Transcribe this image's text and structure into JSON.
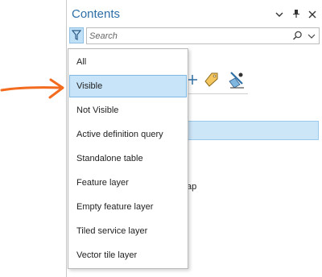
{
  "pane": {
    "title": "Contents",
    "controls": {
      "menu_icon": "chevron-down-icon",
      "pin_icon": "pin-icon",
      "close_icon": "close-icon"
    }
  },
  "search": {
    "placeholder": "Search",
    "search_icon": "magnifier-icon",
    "dropdown_icon": "chevron-down-icon"
  },
  "filter": {
    "icon": "filter-funnel-icon",
    "options": [
      "All",
      "Visible",
      "Not Visible",
      "Active definition query",
      "Standalone table",
      "Feature layer",
      "Empty feature layer",
      "Tiled service layer",
      "Vector tile layer"
    ],
    "selected_index": 1
  },
  "background_fragments": {
    "partial_text": "ap"
  },
  "annotation": {
    "arrow_color": "#f26b1f"
  },
  "colors": {
    "title_blue": "#2e6fa6",
    "selection_fill": "#c8e4f8",
    "selection_border": "#7fb8e3"
  }
}
